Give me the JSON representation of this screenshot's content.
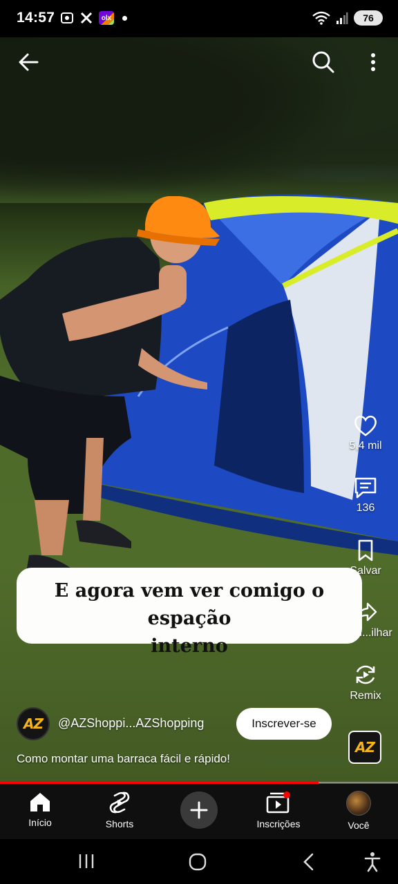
{
  "status_bar": {
    "time": "14:57",
    "battery": "76",
    "notification_icons": [
      "screen-record-icon",
      "x-icon",
      "olx-icon"
    ],
    "olx_label": "olx",
    "right_icons": [
      "wifi-icon",
      "signal-icon",
      "battery-icon"
    ]
  },
  "top_bar": {
    "icons": [
      "back-arrow-icon",
      "search-icon",
      "more-vertical-icon"
    ]
  },
  "right_rail": {
    "like_count": "5,4 mil",
    "comments_count": "136",
    "save_label": "Salvar",
    "share_label": "Com...ilhar",
    "remix_label": "Remix"
  },
  "caption": {
    "line1": "E agora vem ver comigo o espação",
    "line2": "interno"
  },
  "channel": {
    "avatar_text": "AZ",
    "handle": "@AZShoppi...AZShopping",
    "subscribe_label": "Inscrever-se"
  },
  "video": {
    "title": "Como montar uma barraca fácil e rápido!",
    "progress": 0.8
  },
  "sound_thumb": {
    "text": "AZ"
  },
  "bottom_nav": {
    "items": [
      {
        "label": "Início",
        "icon": "home-icon"
      },
      {
        "label": "Shorts",
        "icon": "shorts-icon"
      },
      {
        "label": "",
        "icon": "plus-icon"
      },
      {
        "label": "Inscrições",
        "icon": "subscriptions-icon"
      },
      {
        "label": "Você",
        "icon": "avatar"
      }
    ]
  },
  "system_nav": {
    "icons": [
      "recent-apps-icon",
      "home-circle-icon",
      "back-chevron-icon",
      "accessibility-icon"
    ]
  },
  "colors": {
    "accent_red": "#ff0000",
    "tent_blue": "#1f4fc8",
    "hat_orange": "#ff8a12",
    "brand_gold": "#f3b51b"
  }
}
